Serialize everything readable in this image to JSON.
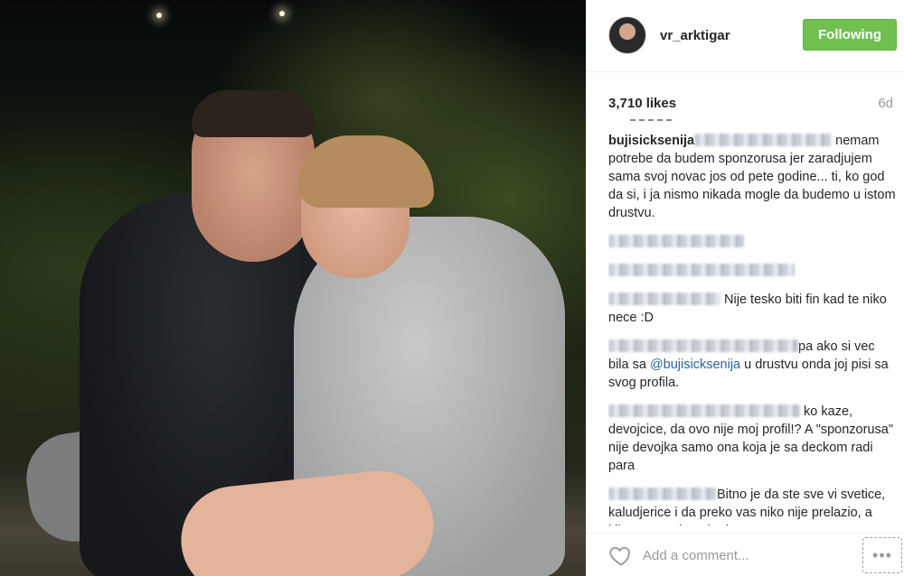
{
  "post": {
    "username": "vr_arktigar",
    "follow_label": "Following",
    "likes": "3,710 likes",
    "age": "6d"
  },
  "comments": [
    {
      "user": "bujisicksenija",
      "blur_w": 152,
      "text": "nemam potrebe da budem sponzorusa jer zaradjujem sama svoj novac jos od pete godine... ti, ko god da si, i ja nismo nikada mogle da budemo u istom drustvu."
    },
    {
      "blur_w": 150,
      "text": ""
    },
    {
      "blur_w": 206,
      "text": ""
    },
    {
      "blur_w": 124,
      "text": "Nije tesko biti fin kad te niko nece :D"
    },
    {
      "blur_w": 210,
      "text_before": "pa ako si vec bila sa ",
      "mention": "@bujisicksenija",
      "text_after": " u drustvu onda joj pisi sa svog profila."
    },
    {
      "blur_w": 212,
      "text": "ko kaze, devojcice, da ovo nije moj profil!? A \"sponzorusa\" nije devojka samo ona koja je sa deckom radi para"
    },
    {
      "blur_w": 120,
      "text": "Bitno je da ste sve vi svetice, kaludjerice i da preko vas niko nije prelazio, a kilometraza kao Ikarbus"
    }
  ],
  "footer": {
    "placeholder": "Add a comment...",
    "more_label": "•••"
  },
  "icons": {
    "heart": "heart-icon",
    "more": "more-options-icon"
  },
  "colors": {
    "follow_bg": "#70c050",
    "mention": "#2b64a0"
  }
}
